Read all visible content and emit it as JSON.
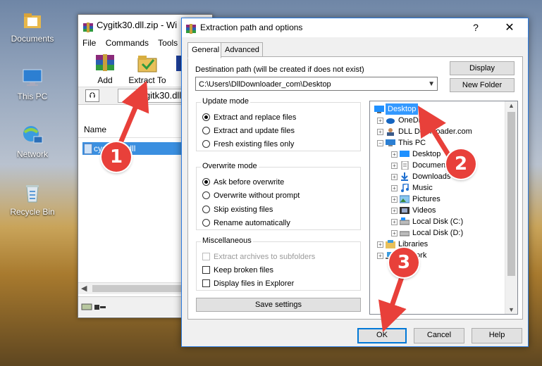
{
  "desktop": {
    "icons": [
      {
        "label": "Documents"
      },
      {
        "label": "This PC"
      },
      {
        "label": "Network"
      },
      {
        "label": "Recycle Bin"
      }
    ]
  },
  "winrar": {
    "title": "Cygitk30.dll.zip - Wi",
    "menu": [
      "File",
      "Commands",
      "Tools"
    ],
    "toolbar": {
      "add": "Add",
      "extract_to": "Extract To"
    },
    "path": "Cygitk30.dll",
    "column_name": "Name",
    "file": "cygitk30.dll"
  },
  "dialog": {
    "title": "Extraction path and options",
    "help": "?",
    "close": "✕",
    "tabs": [
      "General",
      "Advanced"
    ],
    "dest_label": "Destination path (will be created if does not exist)",
    "dest_value": "C:\\Users\\DllDownloader_com\\Desktop",
    "display_btn": "Display",
    "new_folder_btn": "New Folder",
    "update_mode": {
      "title": "Update mode",
      "options": [
        "Extract and replace files",
        "Extract and update files",
        "Fresh existing files only"
      ],
      "selected": 0
    },
    "overwrite_mode": {
      "title": "Overwrite mode",
      "options": [
        "Ask before overwrite",
        "Overwrite without prompt",
        "Skip existing files",
        "Rename automatically"
      ],
      "selected": 0
    },
    "misc": {
      "title": "Miscellaneous",
      "options": [
        "Extract archives to subfolders",
        "Keep broken files",
        "Display files in Explorer"
      ]
    },
    "save_settings": "Save settings",
    "tree": [
      "Desktop",
      "OneDrive",
      "DLL Downloader.com",
      "This PC",
      "Desktop",
      "Documents",
      "Downloads",
      "Music",
      "Pictures",
      "Videos",
      "Local Disk (C:)",
      "Local Disk (D:)",
      "Libraries",
      "Network"
    ],
    "ok": "OK",
    "cancel": "Cancel",
    "help_btn": "Help"
  },
  "annotations": [
    "1",
    "2",
    "3"
  ],
  "colors": {
    "accent": "#0078d7",
    "selection": "#3399ff",
    "badge": "#e8403a"
  }
}
